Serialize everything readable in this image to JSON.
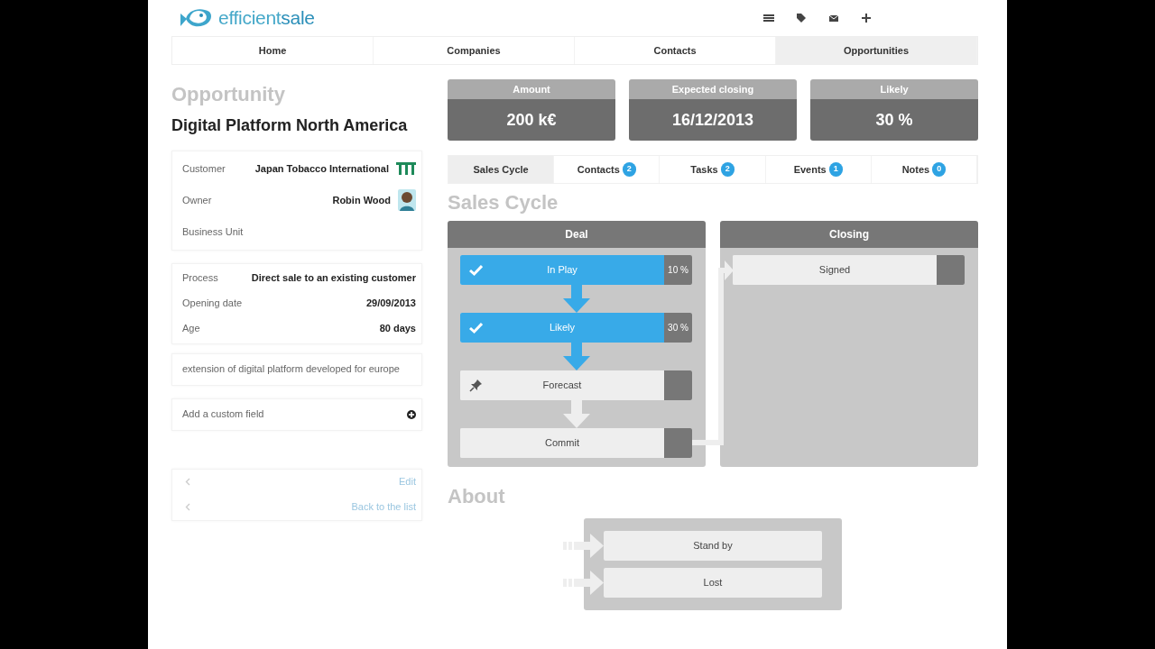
{
  "logo": {
    "light": "efficient",
    "bold": "sale"
  },
  "nav": [
    {
      "label": "Home",
      "selected": false
    },
    {
      "label": "Companies",
      "selected": false
    },
    {
      "label": "Contacts",
      "selected": false
    },
    {
      "label": "Opportunities",
      "selected": true
    }
  ],
  "page_heading": "Opportunity",
  "opportunity_name": "Digital Platform North America",
  "detail_groups": [
    {
      "rows": [
        {
          "label": "Customer",
          "value": "Japan Tobacco International",
          "kind": "company"
        },
        {
          "label": "Owner",
          "value": "Robin Wood",
          "kind": "person"
        },
        {
          "label": "Business Unit"
        }
      ]
    },
    {
      "rows": [
        {
          "label": "Process",
          "value": "Direct sale to an existing customer"
        },
        {
          "label": "Opening date",
          "value": "29/09/2013"
        },
        {
          "label": "Age",
          "value": "80 days"
        }
      ]
    }
  ],
  "description": "extension of digital platform developed for europe",
  "custom_field": "Add a custom field",
  "links": [
    "Edit",
    "Back to the list"
  ],
  "metrics": [
    {
      "label": "Amount",
      "value": "200 k€"
    },
    {
      "label": "Expected closing",
      "value": "16/12/2013"
    },
    {
      "label": "Likely",
      "value": "30 %"
    }
  ],
  "tabs": [
    {
      "label": "Sales Cycle",
      "selected": true
    },
    {
      "label": "Contacts",
      "count": "2",
      "selected": false
    },
    {
      "label": "Tasks",
      "count": "2",
      "selected": false
    },
    {
      "label": "Events",
      "count": "1",
      "selected": false
    },
    {
      "label": "Notes",
      "count": "0",
      "selected": false
    }
  ],
  "section_heading": "Sales Cycle",
  "phases": [
    {
      "title": "Deal",
      "stages": [
        {
          "label": "In Play",
          "done": true,
          "pinned": false,
          "percent": "10 %"
        },
        {
          "label": "Likely",
          "done": true,
          "pinned": false,
          "percent": "30 %"
        },
        {
          "label": "Forecast",
          "done": false,
          "pinned": true
        },
        {
          "label": "Commit",
          "done": false,
          "pinned": false
        }
      ]
    },
    {
      "title": "Closing",
      "stages": [
        {
          "label": "Signed",
          "done": false,
          "pinned": false
        }
      ]
    }
  ],
  "about_heading": "About",
  "about_stages": [
    "Stand by",
    "Lost"
  ]
}
